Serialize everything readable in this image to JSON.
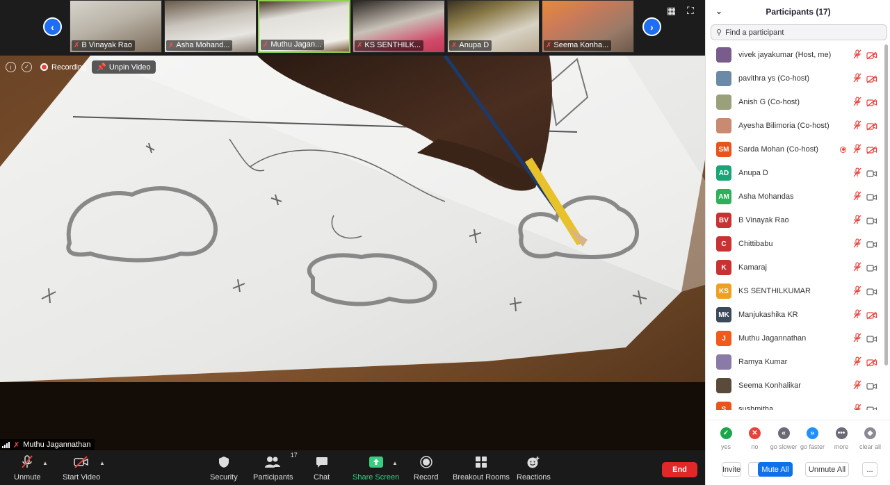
{
  "thumbnails": [
    {
      "name": "B Vinayak Rao",
      "muted": true,
      "active": false
    },
    {
      "name": "Asha Mohand...",
      "muted": true,
      "active": false
    },
    {
      "name": "Muthu Jagan...",
      "muted": true,
      "active": true
    },
    {
      "name": "KS SENTHILK...",
      "muted": true,
      "active": false
    },
    {
      "name": "Anupa D",
      "muted": true,
      "active": false
    },
    {
      "name": "Seema Konha...",
      "muted": true,
      "active": false
    }
  ],
  "status": {
    "recording_label": "Recording",
    "unpin_label": "Unpin Video"
  },
  "active_speaker": "Muthu Jagannathan",
  "toolbar": {
    "unmute": "Unmute",
    "start_video": "Start Video",
    "security": "Security",
    "participants": "Participants",
    "participants_count": "17",
    "chat": "Chat",
    "share_screen": "Share Screen",
    "record": "Record",
    "breakout_rooms": "Breakout Rooms",
    "reactions": "Reactions",
    "end": "End"
  },
  "panel": {
    "title": "Participants (17)",
    "search_placeholder": "Find a participant",
    "participants": [
      {
        "name": "vivek jayakumar (Host, me)",
        "initials": "",
        "color": "#7a5c8c",
        "video": false,
        "recording": false
      },
      {
        "name": "pavithra ys (Co-host)",
        "initials": "",
        "color": "#6a8aa8",
        "video": false,
        "recording": false
      },
      {
        "name": "Anish G (Co-host)",
        "initials": "",
        "color": "#9aa07a",
        "video": false,
        "recording": false
      },
      {
        "name": "Ayesha Bilimoria (Co-host)",
        "initials": "",
        "color": "#c88a70",
        "video": false,
        "recording": false
      },
      {
        "name": "Sarda Mohan (Co-host)",
        "initials": "SM",
        "color": "#e8541c",
        "video": false,
        "recording": true
      },
      {
        "name": "Anupa D",
        "initials": "AD",
        "color": "#1aa576",
        "video": true,
        "recording": false
      },
      {
        "name": "Asha Mohandas",
        "initials": "AM",
        "color": "#2eb05a",
        "video": true,
        "recording": false
      },
      {
        "name": "B Vinayak Rao",
        "initials": "BV",
        "color": "#c83232",
        "video": true,
        "recording": false
      },
      {
        "name": "Chittibabu",
        "initials": "C",
        "color": "#c83232",
        "video": true,
        "recording": false
      },
      {
        "name": "Kamaraj",
        "initials": "K",
        "color": "#c83232",
        "video": true,
        "recording": false
      },
      {
        "name": "KS SENTHILKUMAR",
        "initials": "KS",
        "color": "#f0a020",
        "video": true,
        "recording": false
      },
      {
        "name": "Manjukashika KR",
        "initials": "MK",
        "color": "#3a4a5a",
        "video": false,
        "recording": false
      },
      {
        "name": "Muthu Jagannathan",
        "initials": "J",
        "color": "#f05a1a",
        "video": true,
        "recording": false
      },
      {
        "name": "Ramya Kumar",
        "initials": "",
        "color": "#8a7aa8",
        "video": false,
        "recording": false
      },
      {
        "name": "Seema Konhalikar",
        "initials": "",
        "color": "#5a4a3a",
        "video": true,
        "recording": false
      },
      {
        "name": "sushmitha",
        "initials": "S",
        "color": "#e8541c",
        "video": true,
        "recording": false
      }
    ],
    "feedback": [
      {
        "label": "yes",
        "glyph": "✓",
        "color": "#1aa64b"
      },
      {
        "label": "no",
        "glyph": "✕",
        "color": "#e8423a"
      },
      {
        "label": "go slower",
        "glyph": "«",
        "color": "#6b6b78"
      },
      {
        "label": "go faster",
        "glyph": "»",
        "color": "#1e90ff"
      },
      {
        "label": "more",
        "glyph": "•••",
        "color": "#6b6b78"
      },
      {
        "label": "clear all",
        "glyph": "◆",
        "color": "#8a8a95"
      }
    ],
    "actions": {
      "invite": "Invite",
      "mute_all": "Mute All",
      "unmute_all": "Unmute All",
      "more": "..."
    }
  },
  "colors": {
    "accent": "#0e71eb",
    "end_button": "#e02828",
    "share_green": "#35d07f"
  }
}
